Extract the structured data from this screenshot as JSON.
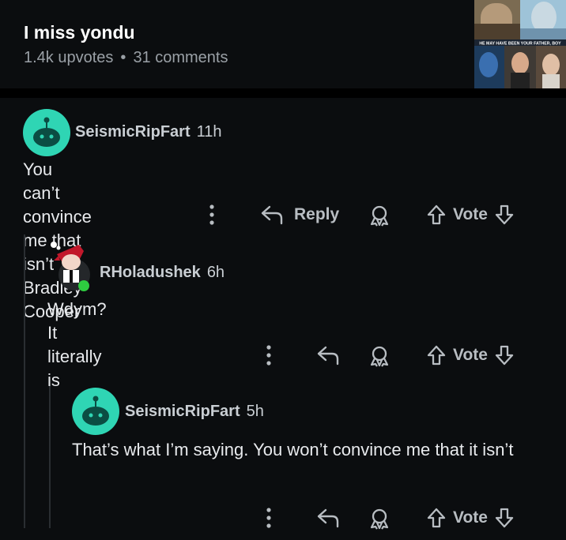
{
  "post": {
    "title": "I miss yondu",
    "upvotes": "1.4k upvotes",
    "separator": "•",
    "comments": "31 comments",
    "thumbnail_caption": "HE MAY HAVE BEEN YOUR FATHER, BOY"
  },
  "comments": [
    {
      "username": "SeismicRipFart",
      "age": "11h",
      "text": "You can’t convince me that isn’t Bradley Cooper",
      "reply_label": "Reply",
      "vote_label": "Vote"
    },
    {
      "username": "RHoladushek",
      "age": "6h",
      "text": "Wdym? It literally is",
      "vote_label": "Vote"
    },
    {
      "username": "SeismicRipFart",
      "age": "5h",
      "text": "That’s what I’m saying. You won’t convince me that it isn’t",
      "vote_label": "Vote"
    }
  ],
  "colors": {
    "background": "#0b0d0f",
    "avatar_teal": "#2fd5b4",
    "online_dot": "#2ecc40",
    "meta_gray": "#9aa0a6"
  },
  "icons": [
    "more-icon",
    "reply-icon",
    "award-icon",
    "upvote-icon",
    "downvote-icon"
  ]
}
